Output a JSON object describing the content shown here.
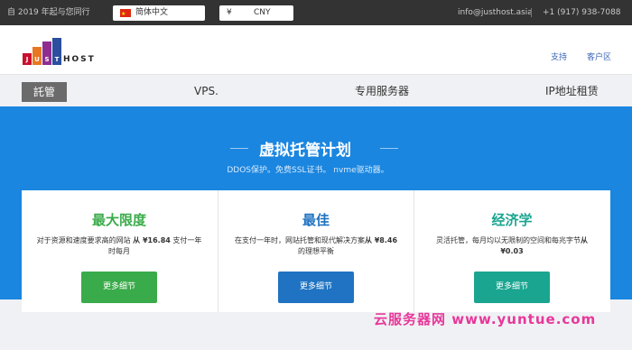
{
  "topbar": {
    "since": "自 2019 年起与您同行",
    "language": "简体中文",
    "currency_symbol": "¥",
    "currency": "CNY",
    "email": "info@justhost.asia",
    "phone": "+1 (917) 938-7088"
  },
  "header": {
    "logo_letters": [
      "J",
      "U",
      "S",
      "T"
    ],
    "logo_text": "HOST",
    "support": "支持",
    "client_area": "客户区"
  },
  "nav": {
    "items": [
      "託管",
      "VPS.",
      "专用服务器",
      "IP地址租赁"
    ]
  },
  "hero": {
    "title": "虚拟托管计划",
    "subtitle": "DDOS保护。免费SSL证书。 nvme驱动器。"
  },
  "plans": [
    {
      "name": "最大限度",
      "desc_pre": "对于资源和速度要求高的网站 ",
      "price": "从 ¥16.84",
      "desc_post": " 支付一年时每月",
      "button": "更多细节",
      "color": "#3aab4a",
      "title_color": "#3aab4a"
    },
    {
      "name": "最佳",
      "desc_pre": "在支付一年时，网站托管和现代解决方案",
      "price": "从 ¥8.46",
      "desc_post": "的理想平衡",
      "button": "更多细节",
      "color": "#1f73c2",
      "title_color": "#1f73c2"
    },
    {
      "name": "经济学",
      "desc_pre": "灵活托管，每月均以无限制的空间和每兆字节",
      "price": "从 ¥0.03",
      "desc_post": "",
      "button": "更多细节",
      "color": "#1aa590",
      "title_color": "#1aa590"
    }
  ],
  "watermark": "云服务器网 www.yuntue.com"
}
